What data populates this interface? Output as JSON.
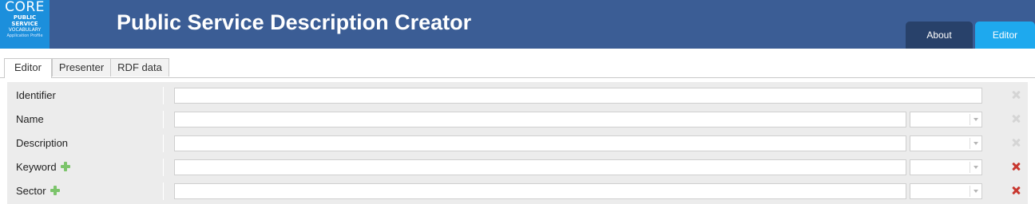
{
  "logo": {
    "line1": "CORE",
    "line2": "PUBLIC",
    "line3": "SERVICE",
    "line4": "VOCABULARY",
    "line5": "Application Profile"
  },
  "header": {
    "title": "Public Service Description Creator",
    "tabs": {
      "about": "About",
      "editor": "Editor"
    },
    "active_tab": "Editor"
  },
  "subtabs": {
    "items": [
      "Editor",
      "Presenter",
      "RDF data"
    ],
    "active": "Editor"
  },
  "form": {
    "rows": [
      {
        "label": "Identifier",
        "value": "",
        "has_language_select": false,
        "has_add": false,
        "remove_enabled": false
      },
      {
        "label": "Name",
        "value": "",
        "language": "",
        "has_language_select": true,
        "has_add": false,
        "remove_enabled": false
      },
      {
        "label": "Description",
        "value": "",
        "language": "",
        "has_language_select": true,
        "has_add": false,
        "remove_enabled": false
      },
      {
        "label": "Keyword",
        "value": "",
        "language": "",
        "has_language_select": true,
        "has_add": true,
        "remove_enabled": true
      },
      {
        "label": "Sector",
        "value": "",
        "language": "",
        "has_language_select": true,
        "has_add": true,
        "remove_enabled": true
      }
    ]
  },
  "icons": {
    "add": "plus-icon",
    "remove": "remove-x-icon",
    "dropdown": "chevron-down-icon"
  },
  "colors": {
    "header_bg": "#3b5d95",
    "logo_bg": "#1c8fdc",
    "tab_about_bg": "#28416a",
    "tab_editor_bg": "#1ea9ee",
    "add_green": "#7cc46b",
    "remove_red": "#c8372f"
  }
}
